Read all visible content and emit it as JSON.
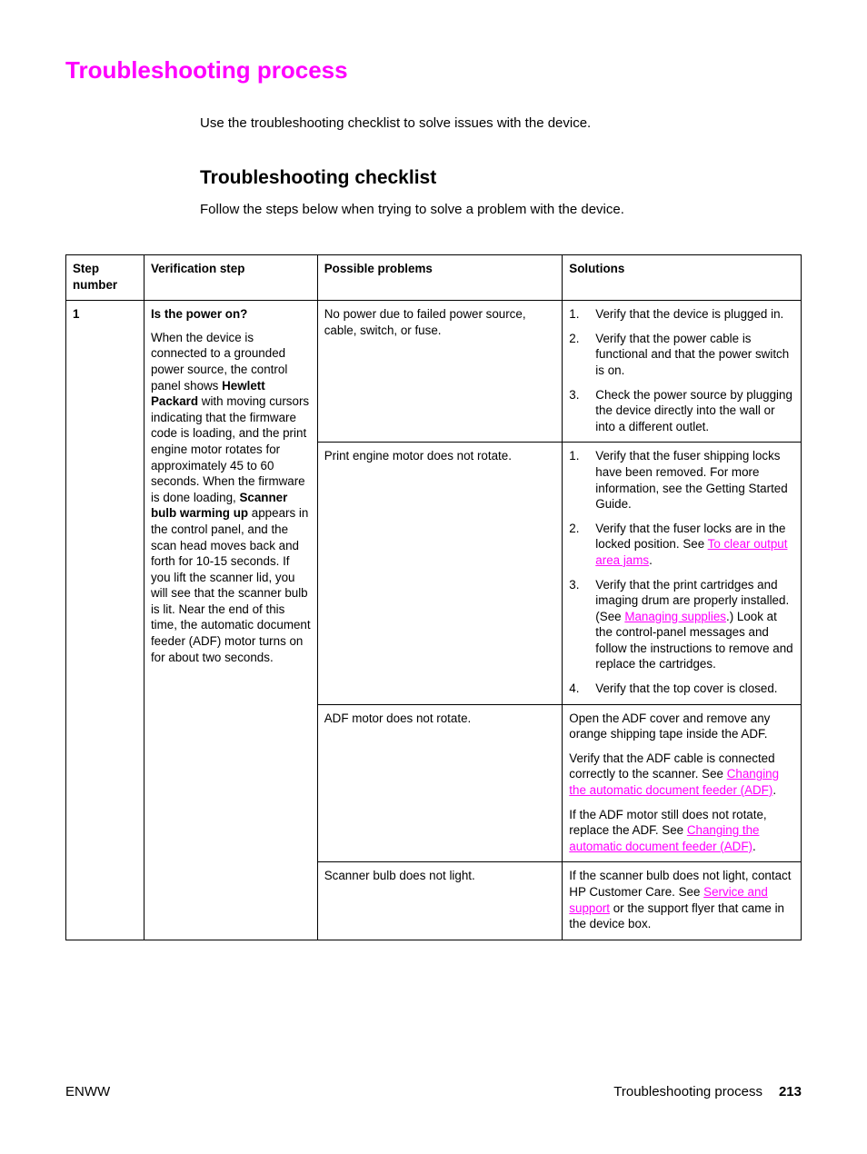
{
  "page": {
    "title": "Troubleshooting process",
    "intro": "Use the troubleshooting checklist to solve issues with the device.",
    "section_title": "Troubleshooting checklist",
    "section_intro": "Follow the steps below when trying to solve a problem with the device."
  },
  "colors": {
    "heading": "#ff00ff",
    "link": "#ff00ff",
    "text": "#000000"
  },
  "table": {
    "headers": [
      "Step number",
      "Verification step",
      "Possible problems",
      "Solutions"
    ],
    "step": {
      "number": "1",
      "title": "Is the power on?",
      "body": [
        {
          "t": "When the device is connected to a grounded power source, the control panel shows "
        },
        {
          "t": "Hewlett Packard",
          "b": true
        },
        {
          "t": " with moving cursors indicating that the firmware code is loading, and the print engine motor rotates for approximately 45 to 60 seconds. When the firmware is done loading, "
        },
        {
          "t": "Scanner bulb warming up",
          "b": true
        },
        {
          "t": " appears in the control panel, and the scan head moves back and forth for 10-15 seconds. If you lift the scanner lid, you will see that the scanner bulb is lit. Near the end of this time, the automatic document feeder (ADF) motor turns on for about two seconds."
        }
      ]
    },
    "rows": [
      {
        "problem": "No power due to failed power source, cable, switch, or fuse.",
        "solution_type": "list",
        "solutions": [
          {
            "num": "1.",
            "parts": [
              {
                "t": "Verify that the device is plugged in."
              }
            ]
          },
          {
            "num": "2.",
            "parts": [
              {
                "t": "Verify that the power cable is functional and that the power switch is on."
              }
            ]
          },
          {
            "num": "3.",
            "parts": [
              {
                "t": "Check the power source by plugging the device directly into the wall or into a different outlet."
              }
            ]
          }
        ]
      },
      {
        "problem": "Print engine motor does not rotate.",
        "solution_type": "list",
        "solutions": [
          {
            "num": "1.",
            "parts": [
              {
                "t": "Verify that the fuser shipping locks have been removed. For more information, see the Getting Started Guide."
              }
            ]
          },
          {
            "num": "2.",
            "parts": [
              {
                "t": "Verify that the fuser locks are in the locked position. See "
              },
              {
                "t": "To clear output area jams",
                "link": true
              },
              {
                "t": "."
              }
            ]
          },
          {
            "num": "3.",
            "parts": [
              {
                "t": "Verify that the print cartridges and imaging drum are properly installed. (See "
              },
              {
                "t": "Managing supplies",
                "link": true
              },
              {
                "t": ".) Look at the control-panel messages and follow the instructions to remove and replace the cartridges."
              }
            ]
          },
          {
            "num": "4.",
            "parts": [
              {
                "t": "Verify that the top cover is closed."
              }
            ]
          }
        ]
      },
      {
        "problem": "ADF motor does not rotate.",
        "solution_type": "paragraphs",
        "solutions": [
          {
            "parts": [
              {
                "t": "Open the ADF cover and remove any orange shipping tape inside the ADF."
              }
            ]
          },
          {
            "parts": [
              {
                "t": "Verify that the ADF cable is connected correctly to the scanner. See "
              },
              {
                "t": "Changing the automatic document feeder (ADF)",
                "link": true
              },
              {
                "t": "."
              }
            ]
          },
          {
            "parts": [
              {
                "t": "If the ADF motor still does not rotate, replace the ADF. See "
              },
              {
                "t": "Changing the automatic document feeder (ADF)",
                "link": true
              },
              {
                "t": "."
              }
            ]
          }
        ]
      },
      {
        "problem": "Scanner bulb does not light.",
        "solution_type": "paragraphs",
        "solutions": [
          {
            "parts": [
              {
                "t": "If the scanner bulb does not light, contact HP Customer Care. See "
              },
              {
                "t": "Service and support",
                "link": true
              },
              {
                "t": " or the support flyer that came in the device box."
              }
            ]
          }
        ]
      }
    ]
  },
  "footer": {
    "left": "ENWW",
    "section": "Troubleshooting process",
    "page_number": "213"
  }
}
